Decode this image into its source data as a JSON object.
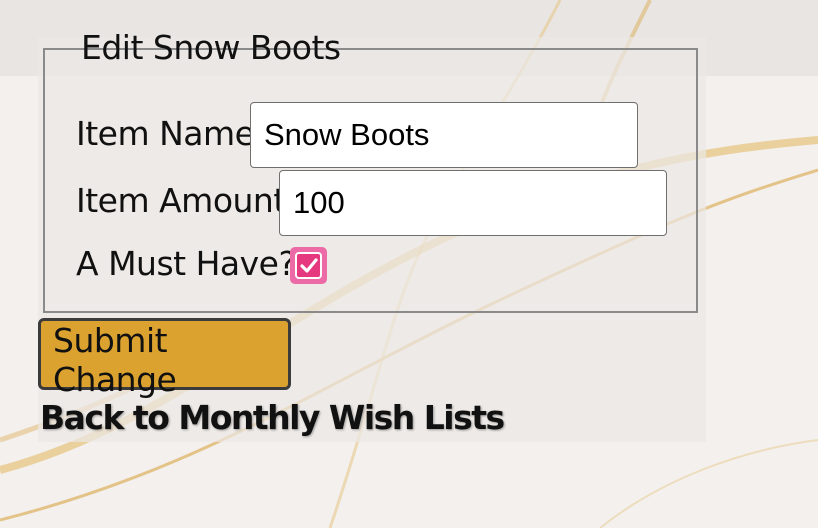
{
  "form": {
    "legend": "Edit Snow Boots",
    "item_name_label": "Item Name:",
    "item_name_value": "Snow Boots",
    "item_amount_label": "Item Amount:",
    "item_amount_value": "100",
    "must_have_label": "A Must Have?:",
    "must_have_checked": true,
    "submit_label": "Submit Change"
  },
  "links": {
    "back_label": "Back to Monthly Wish Lists"
  },
  "colors": {
    "background": "#f4f1ef",
    "gold_accent": "#dca22f",
    "checkbox": "#e6387f",
    "panel": "#ece8e5"
  }
}
